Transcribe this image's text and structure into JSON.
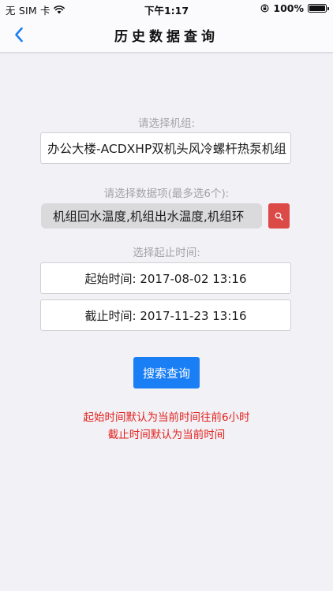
{
  "status_bar": {
    "carrier": "无 SIM 卡",
    "time": "下午1:17",
    "battery": "100%"
  },
  "nav": {
    "title": "历史数据查询",
    "back_icon": "chevron-left-icon"
  },
  "form": {
    "unit_label": "请选择机组:",
    "unit_value": "办公大楼-ACDXHP双机头风冷螺杆热泵机组",
    "items_label": "请选择数据项(最多选6个):",
    "items_value": "机组回水温度,机组出水温度,机组环",
    "time_label": "选择起止时间:",
    "start_time": "起始时间: 2017-08-02 13:16",
    "end_time": "截止时间: 2017-11-23 13:16",
    "search_label": "搜索查询"
  },
  "notes": {
    "line1": "起始时间默认为当前时间往前6小时",
    "line2": "截止时间默认为当前时间"
  },
  "colors": {
    "accent": "#1a7ff5",
    "danger": "#dc4a48",
    "note_text": "#e2211c",
    "background": "#f2f1f6"
  }
}
